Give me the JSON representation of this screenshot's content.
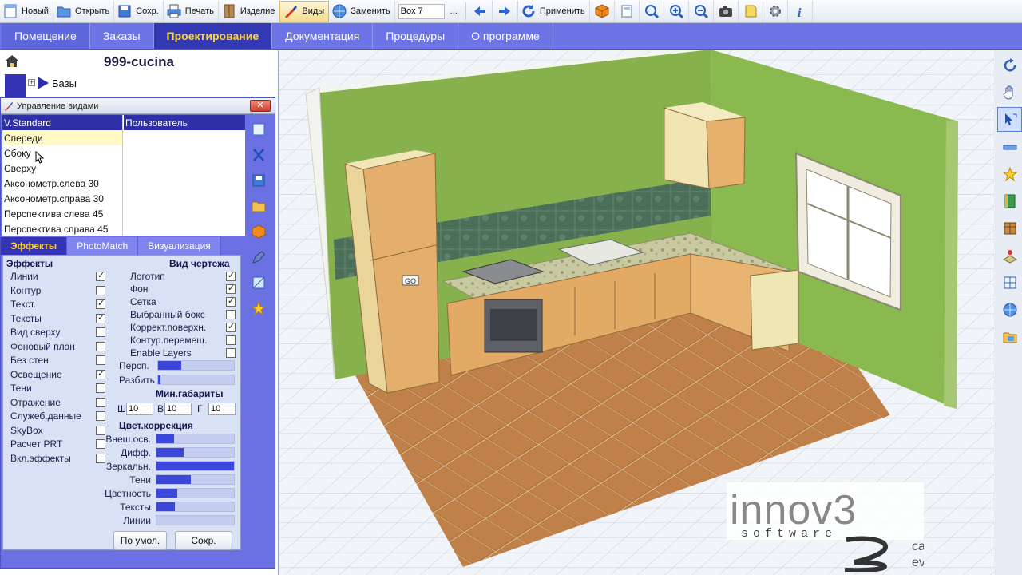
{
  "toolbar": {
    "new_label": "Новый",
    "open_label": "Открыть",
    "save_label": "Сохр.",
    "print_label": "Печать",
    "item_label": "Изделие",
    "views_label": "Виды",
    "replace_label": "Заменить",
    "box_value": "Box 7",
    "more_label": "...",
    "apply_label": "Применить"
  },
  "menu": {
    "items": [
      "Помещение",
      "Заказы",
      "Проектирование",
      "Документация",
      "Процедуры",
      "О программе"
    ],
    "active": "Проектирование"
  },
  "project": {
    "title": "999-cucina",
    "tree_item": "Базы"
  },
  "dialog": {
    "title": "Управление видами",
    "col1_header": "V.Standard",
    "col2_header": "Пользователь",
    "views": [
      "Спереди",
      "Сбоку",
      "Сверху",
      "Аксонометр.слева 30",
      "Аксонометр.справа 30",
      "Перспектива слева 45",
      "Перспектива справа 45"
    ],
    "selected_view": "Спереди",
    "tabs": [
      "Эффекты",
      "PhotoMatch",
      "Визуализация"
    ],
    "active_tab": "Эффекты",
    "effects_header": "Эффекты",
    "effects": [
      {
        "label": "Линии",
        "checked": true
      },
      {
        "label": "Контур",
        "checked": false
      },
      {
        "label": "Текст.",
        "checked": true
      },
      {
        "label": "Тексты",
        "checked": true
      },
      {
        "label": "Вид сверху",
        "checked": false
      },
      {
        "label": "Фоновый план",
        "checked": false
      },
      {
        "label": "Без стен",
        "checked": false
      },
      {
        "label": "Освещение",
        "checked": true
      },
      {
        "label": "Тени",
        "checked": false
      },
      {
        "label": "Отражение",
        "checked": false
      },
      {
        "label": "Служеб.данные",
        "checked": false
      },
      {
        "label": "SkyBox",
        "checked": false
      },
      {
        "label": "Расчет PRT",
        "checked": false
      },
      {
        "label": "Вкл.эффекты",
        "checked": false
      }
    ],
    "drawing_header": "Вид чертежа",
    "drawing": [
      {
        "label": "Логотип",
        "checked": true
      },
      {
        "label": "Фон",
        "checked": true
      },
      {
        "label": "Сетка",
        "checked": true
      },
      {
        "label": "Выбранный бокс",
        "checked": false
      },
      {
        "label": "Коррект.поверхн.",
        "checked": true
      },
      {
        "label": "Контур.перемещ.",
        "checked": false
      },
      {
        "label": "Enable Layers",
        "checked": false
      }
    ],
    "persp_label": "Персп.",
    "persp_level": 0.3,
    "split_label": "Разбить",
    "split_level": 0.03,
    "min_dims_header": "Мин.габариты",
    "dims": [
      {
        "label": "Ш",
        "value": "10"
      },
      {
        "label": "В",
        "value": "10"
      },
      {
        "label": "Г",
        "value": "10"
      }
    ],
    "color_header": "Цвет.коррекция",
    "color_correction": [
      {
        "label": "Внеш.осв.",
        "level": 0.23
      },
      {
        "label": "Дифф.",
        "level": 0.35
      },
      {
        "label": "Зеркальн.",
        "level": 1.0
      },
      {
        "label": "Тени",
        "level": 0.44
      },
      {
        "label": "Цветность",
        "level": 0.27
      },
      {
        "label": "Тексты",
        "level": 0.24
      },
      {
        "label": "Линии",
        "level": 0.0
      }
    ],
    "default_button": "По умол.",
    "save_button": "Сохр."
  },
  "scene": {
    "oven_badge": "GO"
  },
  "brand": {
    "name": "innov3",
    "sub": "software",
    "tag_cad": "cad",
    "tag_evo": "evolution"
  },
  "colors": {
    "accent": "#3333b4",
    "menu": "#6c74e6",
    "active_text": "#ffd21e",
    "wall_green": "#86b14d",
    "cabinet": "#e6b26d"
  }
}
